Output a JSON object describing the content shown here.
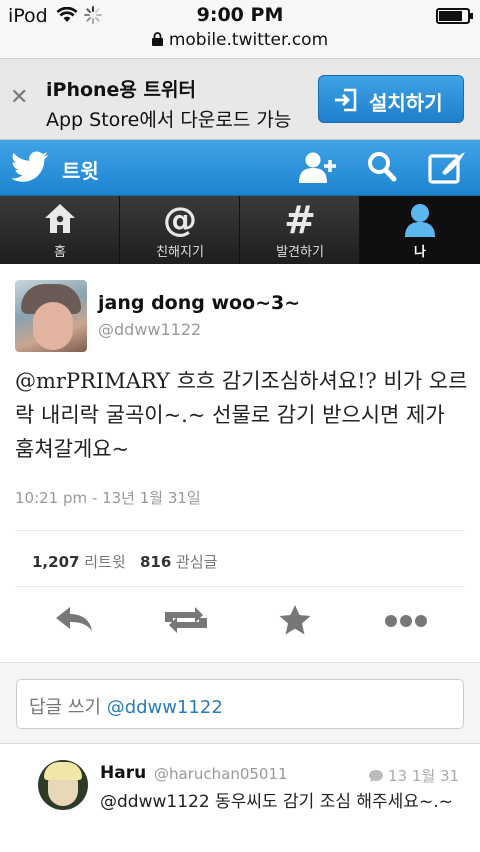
{
  "status_bar": {
    "carrier": "iPod",
    "time": "9:00 PM"
  },
  "url_bar": {
    "url": "mobile.twitter.com"
  },
  "app_banner": {
    "title": "iPhone용 트위터",
    "subtitle": "App Store에서 다운로드 가능",
    "install_label": "설치하기",
    "accent": "#1e7fcc"
  },
  "header": {
    "title": "트윗",
    "accent": "#2b93dc"
  },
  "tabs": [
    {
      "label": "홈",
      "icon": "home-icon"
    },
    {
      "label": "친해지기",
      "icon": "at-icon"
    },
    {
      "label": "발견하기",
      "icon": "hashtag-icon"
    },
    {
      "label": "나",
      "icon": "person-icon",
      "active": true
    }
  ],
  "tweet": {
    "author_name": "jang dong woo~3~",
    "author_handle": "@ddww1122",
    "mention": "@mrPRIMARY",
    "text_rest": " 흐흐 감기조심하셔요!? 비가 오르락 내리락 굴곡이~.~ 선물로 감기 받으시면 제가 훔쳐갈게요~",
    "timestamp": "10:21 pm - 13년 1월 31일",
    "retweet_count": "1,207",
    "retweet_label": "리트윗",
    "favorite_count": "816",
    "favorite_label": "관심글"
  },
  "reply_box": {
    "prefix": "답글 쓰기 ",
    "mention": "@ddww1122"
  },
  "reply": {
    "name": "Haru",
    "handle": "@haruchan05011",
    "date": "13 1월 31",
    "text": "@ddww1122 동우씨도 감기 조심 해주세요~.~"
  }
}
